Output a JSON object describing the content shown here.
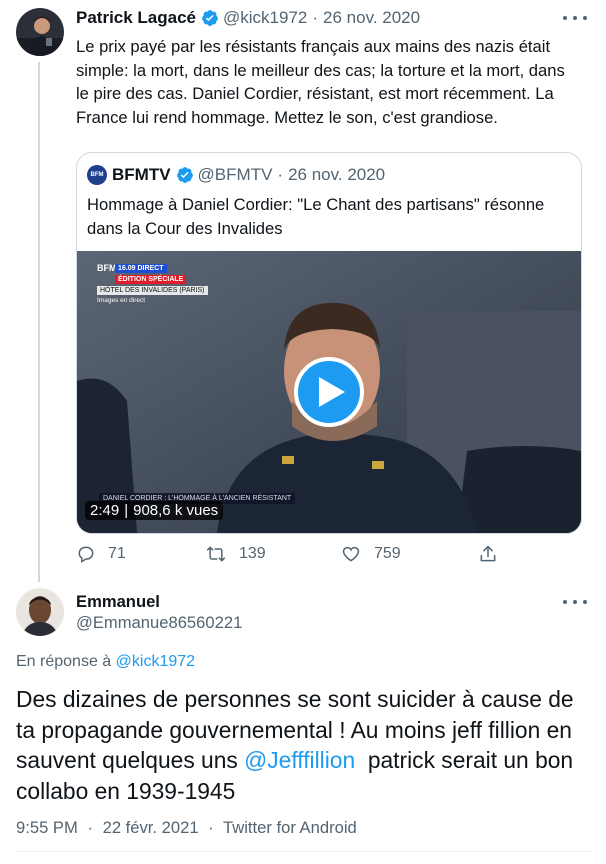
{
  "tweet": {
    "author_name": "Patrick Lagacé",
    "author_handle": "@kick1972",
    "date": "26 nov. 2020",
    "text": "Le prix payé par les résistants français aux mains des nazis était simple: la mort, dans le meilleur des cas; la torture et la mort, dans le pire des cas. Daniel Cordier, résistant, est mort récemment. La France lui rend hommage. Mettez le son, c'est grandiose.",
    "quote": {
      "author_name": "BFMTV",
      "author_handle": "@BFMTV",
      "date": "26 nov. 2020",
      "text": "Hommage à Daniel Cordier: \"Le Chant des partisans\" résonne dans la Cour des Invalides",
      "video": {
        "overlay_brand": "BFM TV.",
        "overlay_time": "16.09 DIRECT",
        "overlay_edition": "ÉDITION SPÉCIALE",
        "overlay_location": "HÔTEL DES INVALIDES (PARIS)",
        "overlay_images": "Images en direct",
        "overlay_lower": "DANIEL CORDIER : L'HOMMAGE À L'ANCIEN RÉSISTANT",
        "duration": "2:49",
        "views": "908,6 k vues"
      }
    },
    "actions": {
      "replies": "71",
      "retweets": "139",
      "likes": "759"
    },
    "colors": {
      "accent": "#1d9bf0",
      "muted": "#536471",
      "thread_line": "#cfd9de"
    }
  },
  "reply": {
    "author_name": "Emmanuel",
    "author_handle": "@Emmanue86560221",
    "reply_prefix": "En réponse à",
    "reply_target": "@kick1972",
    "text_before_mention": "Des dizaines de personnes se sont suicider à cause de ta propagande gouvernemental ! Au moins jeff fillion en sauvent quelques uns ",
    "mention": "@Jefffillion",
    "text_after_mention": "  patrick serait un bon collabo en 1939-1945",
    "time": "9:55 PM",
    "date": "22 févr. 2021",
    "source": "Twitter for Android"
  },
  "icons": {
    "reply": "reply-icon",
    "retweet": "retweet-icon",
    "like": "heart-icon",
    "share": "share-icon",
    "verified": "verified-badge-icon",
    "more": "more-options-icon",
    "play": "play-icon"
  }
}
